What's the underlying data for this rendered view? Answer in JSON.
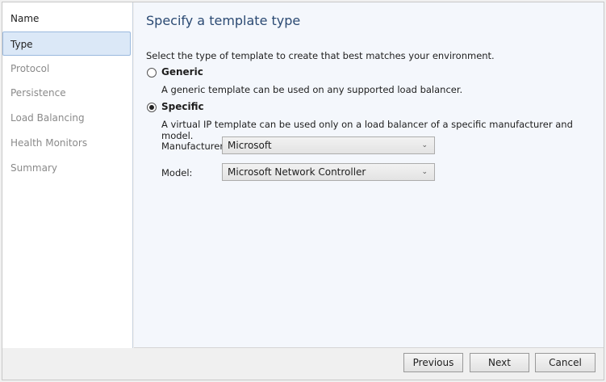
{
  "sidebar": {
    "items": [
      {
        "label": "Name",
        "state": "done"
      },
      {
        "label": "Type",
        "state": "active"
      },
      {
        "label": "Protocol",
        "state": "pending"
      },
      {
        "label": "Persistence",
        "state": "pending"
      },
      {
        "label": "Load Balancing",
        "state": "pending"
      },
      {
        "label": "Health Monitors",
        "state": "pending"
      },
      {
        "label": "Summary",
        "state": "pending"
      }
    ]
  },
  "main": {
    "title": "Specify a template type",
    "instruction": "Select the type of template to create that best matches your environment.",
    "generic": {
      "label": "Generic",
      "description": "A generic template can be used on any supported load balancer.",
      "selected": false
    },
    "specific": {
      "label": "Specific",
      "description": "A virtual IP template can be used only on a load balancer of a specific manufacturer and model.",
      "selected": true
    },
    "manufacturer": {
      "label": "Manufacturer:",
      "value": "Microsoft"
    },
    "model": {
      "label": "Model:",
      "value": "Microsoft Network Controller"
    }
  },
  "footer": {
    "previous": "Previous",
    "next": "Next",
    "cancel": "Cancel"
  }
}
